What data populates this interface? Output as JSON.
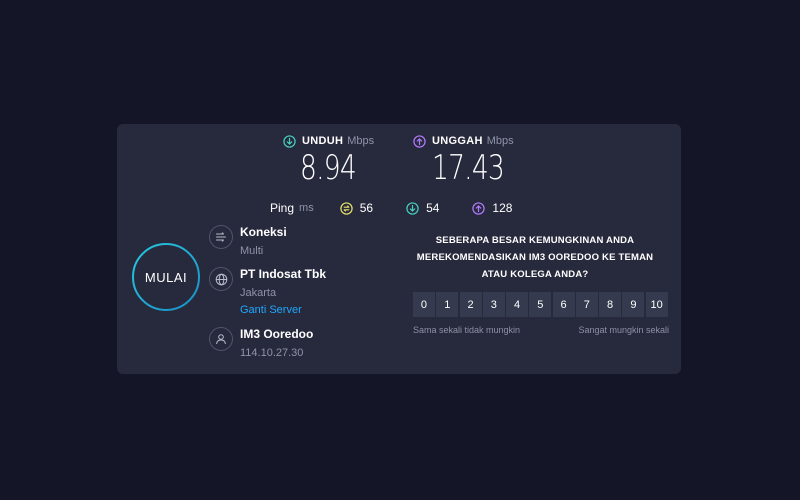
{
  "metrics": {
    "download": {
      "label": "UNDUH",
      "unit": "Mbps",
      "value": "8.94",
      "icon": "arrow-down-circle-icon"
    },
    "upload": {
      "label": "UNGGAH",
      "unit": "Mbps",
      "value": "17.43",
      "icon": "arrow-up-circle-icon"
    }
  },
  "ping": {
    "label": "Ping",
    "unit": "ms",
    "latency": "56",
    "download": "54",
    "upload": "128"
  },
  "go_button": {
    "label": "MULAI"
  },
  "connection": {
    "title": "Koneksi",
    "value": "Multi",
    "icon": "connections-icon"
  },
  "server": {
    "title": "PT Indosat Tbk",
    "location": "Jakarta",
    "change_link": "Ganti Server",
    "icon": "globe-icon"
  },
  "provider": {
    "title": "IM3 Ooredoo",
    "ip": "114.10.27.30",
    "icon": "user-icon"
  },
  "survey": {
    "question": "SEBERAPA BESAR KEMUNGKINAN ANDA MEREKOMENDASIKAN IM3 OOREDOO KE TEMAN ATAU KOLEGA ANDA?",
    "scale": [
      "0",
      "1",
      "2",
      "3",
      "4",
      "5",
      "6",
      "7",
      "8",
      "9",
      "10"
    ],
    "low_label": "Sama sekali tidak mungkin",
    "high_label": "Sangat mungkin sekali"
  },
  "colors": {
    "background": "#141628",
    "card": "#272a3d",
    "download_accent": "#47d1c0",
    "upload_accent": "#b57bff",
    "ping_accent": "#e8e26a",
    "link": "#1fa7ff"
  }
}
